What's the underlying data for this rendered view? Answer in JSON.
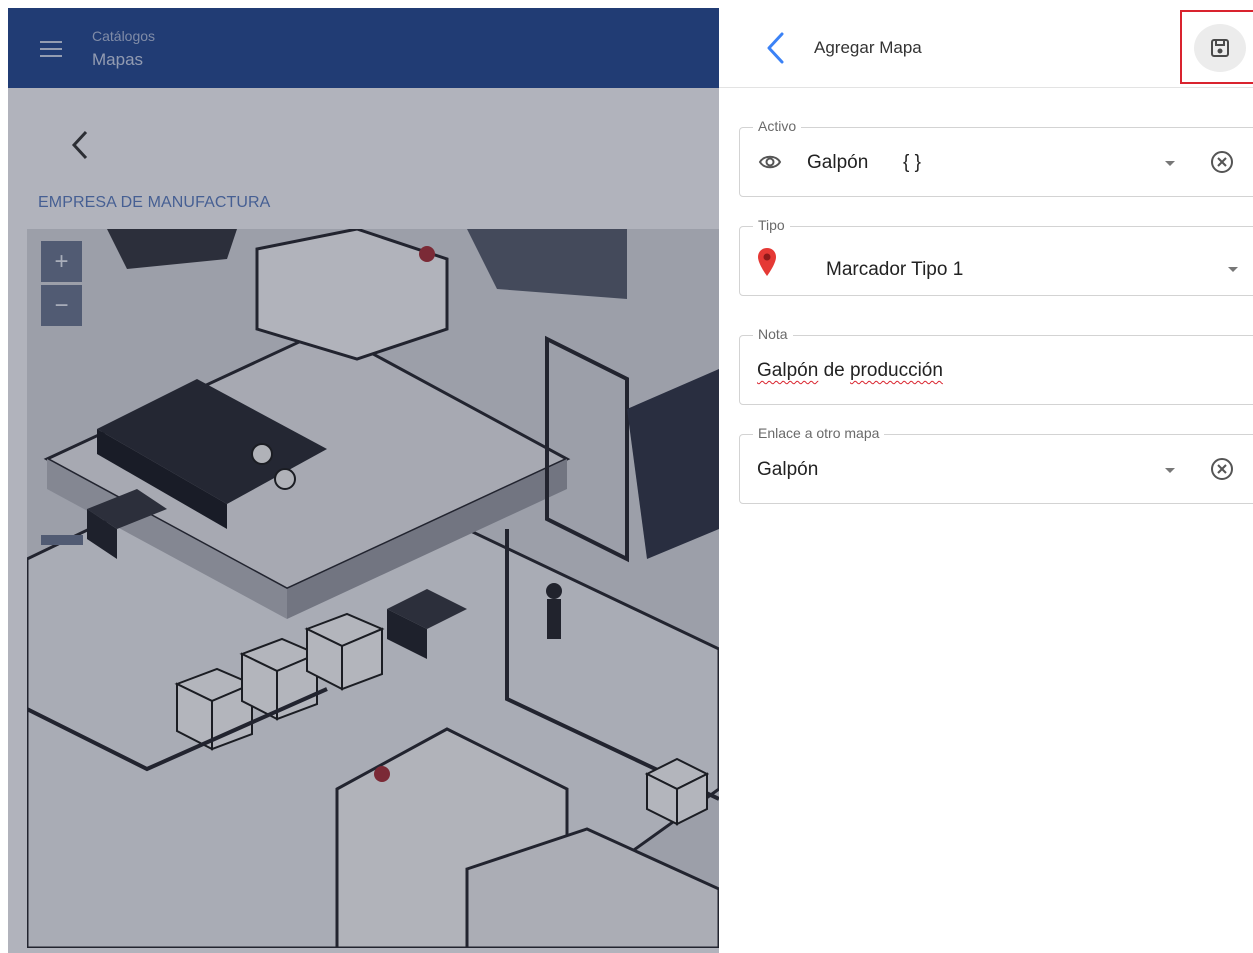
{
  "left": {
    "breadcrumb_parent": "Catálogos",
    "breadcrumb_current": "Mapas",
    "company": "EMPRESA DE MANUFACTURA",
    "zoom_in_label": "+",
    "zoom_out_label": "−"
  },
  "panel": {
    "title": "Agregar Mapa",
    "fields": {
      "activo": {
        "label": "Activo",
        "value": "Galpón",
        "extra": "{ }"
      },
      "tipo": {
        "label": "Tipo",
        "value": "Marcador Tipo 1"
      },
      "nota": {
        "label": "Nota",
        "value_word1": "Galpón",
        "value_word2": "de",
        "value_word3": "producción"
      },
      "enlace": {
        "label": "Enlace a otro mapa",
        "value": "Galpón"
      }
    }
  },
  "colors": {
    "topbar": "#2a4d92",
    "accent": "#3b82f6",
    "highlight": "#d9232e",
    "pin": "#e53935"
  },
  "icons": {
    "menu": "menu-icon",
    "back": "chevron-left-icon",
    "save": "floppy-disk-icon",
    "eye": "eye-icon",
    "pin": "map-pin-icon",
    "clear": "clear-circle-icon",
    "dropdown": "caret-down-icon"
  }
}
